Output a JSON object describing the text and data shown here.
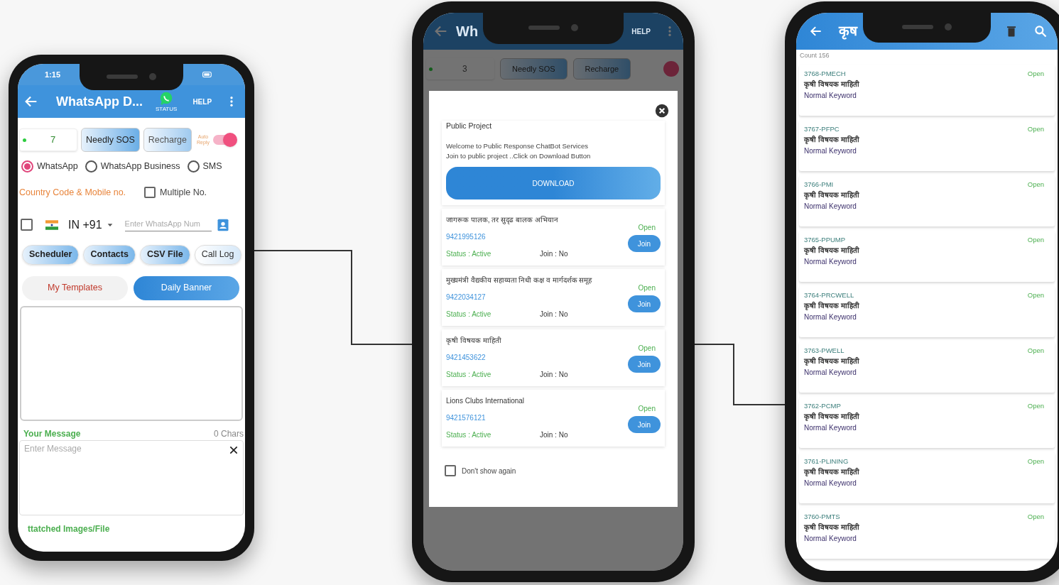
{
  "left_phone": {
    "status_bar": {
      "time": "1:15"
    },
    "app_bar": {
      "title": "WhatsApp D...",
      "status_label": "STATUS",
      "help": "HELP"
    },
    "counter": "7",
    "buttons": [
      "Needly SOS",
      "Recharge"
    ],
    "auto_reply": {
      "label": "Auto Reply",
      "on": true
    },
    "channels": [
      {
        "label": "WhatsApp",
        "selected": true
      },
      {
        "label": "WhatsApp Business",
        "selected": false
      },
      {
        "label": "SMS",
        "selected": false
      }
    ],
    "country_label": "Country Code & Mobile no.",
    "multiple": {
      "label": "Multiple No.",
      "checked": false
    },
    "phone_row": {
      "checked": false,
      "country": "IN +91",
      "placeholder": "Enter WhatsApp Num"
    },
    "sources": [
      "Scheduler",
      "Contacts",
      "CSV File",
      "Call Log"
    ],
    "tabs": [
      {
        "label": "My Templates",
        "selected": false
      },
      {
        "label": "Daily Banner",
        "selected": true
      }
    ],
    "message_label": "Your Message",
    "char_count": "0 Chars",
    "message_placeholder": "Enter Message",
    "attach_label": "ttatched Images/File"
  },
  "middle_phone": {
    "app_bar": {
      "title": "Wh",
      "help": "HELP"
    },
    "counter": "3",
    "buttons": [
      "Needly SOS",
      "Recharge"
    ],
    "dialog": {
      "title": "Public Project",
      "lines": [
        "Welcome to Public Response ChatBot Services",
        "Join to public project ..Click on Download Button"
      ],
      "download": "DOWNLOAD",
      "projects": [
        {
          "name": "जागरूक पालक, तर सुदृढ बालक अभियान",
          "phone": "9421995126",
          "status": "Status : Active",
          "join_state": "Join : No",
          "open": "Open",
          "join": "Join"
        },
        {
          "name": "मुख्यमंत्री वैद्यकीय सहाय्यता निधी कक्ष व मार्गदर्शक समूह",
          "phone": "9422034127",
          "status": "Status : Active",
          "join_state": "Join : No",
          "open": "Open",
          "join": "Join"
        },
        {
          "name": "कृषी विषयक माहिती",
          "phone": "9421453622",
          "status": "Status : Active",
          "join_state": "Join : No",
          "open": "Open",
          "join": "Join"
        },
        {
          "name": "Lions Clubs International",
          "phone": "9421576121",
          "status": "Status : Active",
          "join_state": "Join : No",
          "open": "Open",
          "join": "Join"
        }
      ],
      "dont_show": {
        "label": "Don't show again",
        "checked": false
      }
    }
  },
  "right_phone": {
    "app_bar": {
      "title": "कृष"
    },
    "count": "Count 156",
    "rows": [
      {
        "code": "3768-PMECH",
        "title": "कृषी विषयक माहिती",
        "type": "Normal Keyword",
        "state": "Open"
      },
      {
        "code": "3767-PFPC",
        "title": "कृषी विषयक माहिती",
        "type": "Normal Keyword",
        "state": "Open"
      },
      {
        "code": "3766-PMI",
        "title": "कृषी विषयक माहिती",
        "type": "Normal Keyword",
        "state": "Open"
      },
      {
        "code": "3765-PPUMP",
        "title": "कृषी विषयक माहिती",
        "type": "Normal Keyword",
        "state": "Open"
      },
      {
        "code": "3764-PRCWELL",
        "title": "कृषी विषयक माहिती",
        "type": "Normal Keyword",
        "state": "Open"
      },
      {
        "code": "3763-PWELL",
        "title": "कृषी विषयक माहिती",
        "type": "Normal Keyword",
        "state": "Open"
      },
      {
        "code": "3762-PCMP",
        "title": "कृषी विषयक माहिती",
        "type": "Normal Keyword",
        "state": "Open"
      },
      {
        "code": "3761-PLINING",
        "title": "कृषी विषयक माहिती",
        "type": "Normal Keyword",
        "state": "Open"
      },
      {
        "code": "3760-PMTS",
        "title": "कृषी विषयक माहिती",
        "type": "Normal Keyword",
        "state": "Open"
      }
    ]
  }
}
